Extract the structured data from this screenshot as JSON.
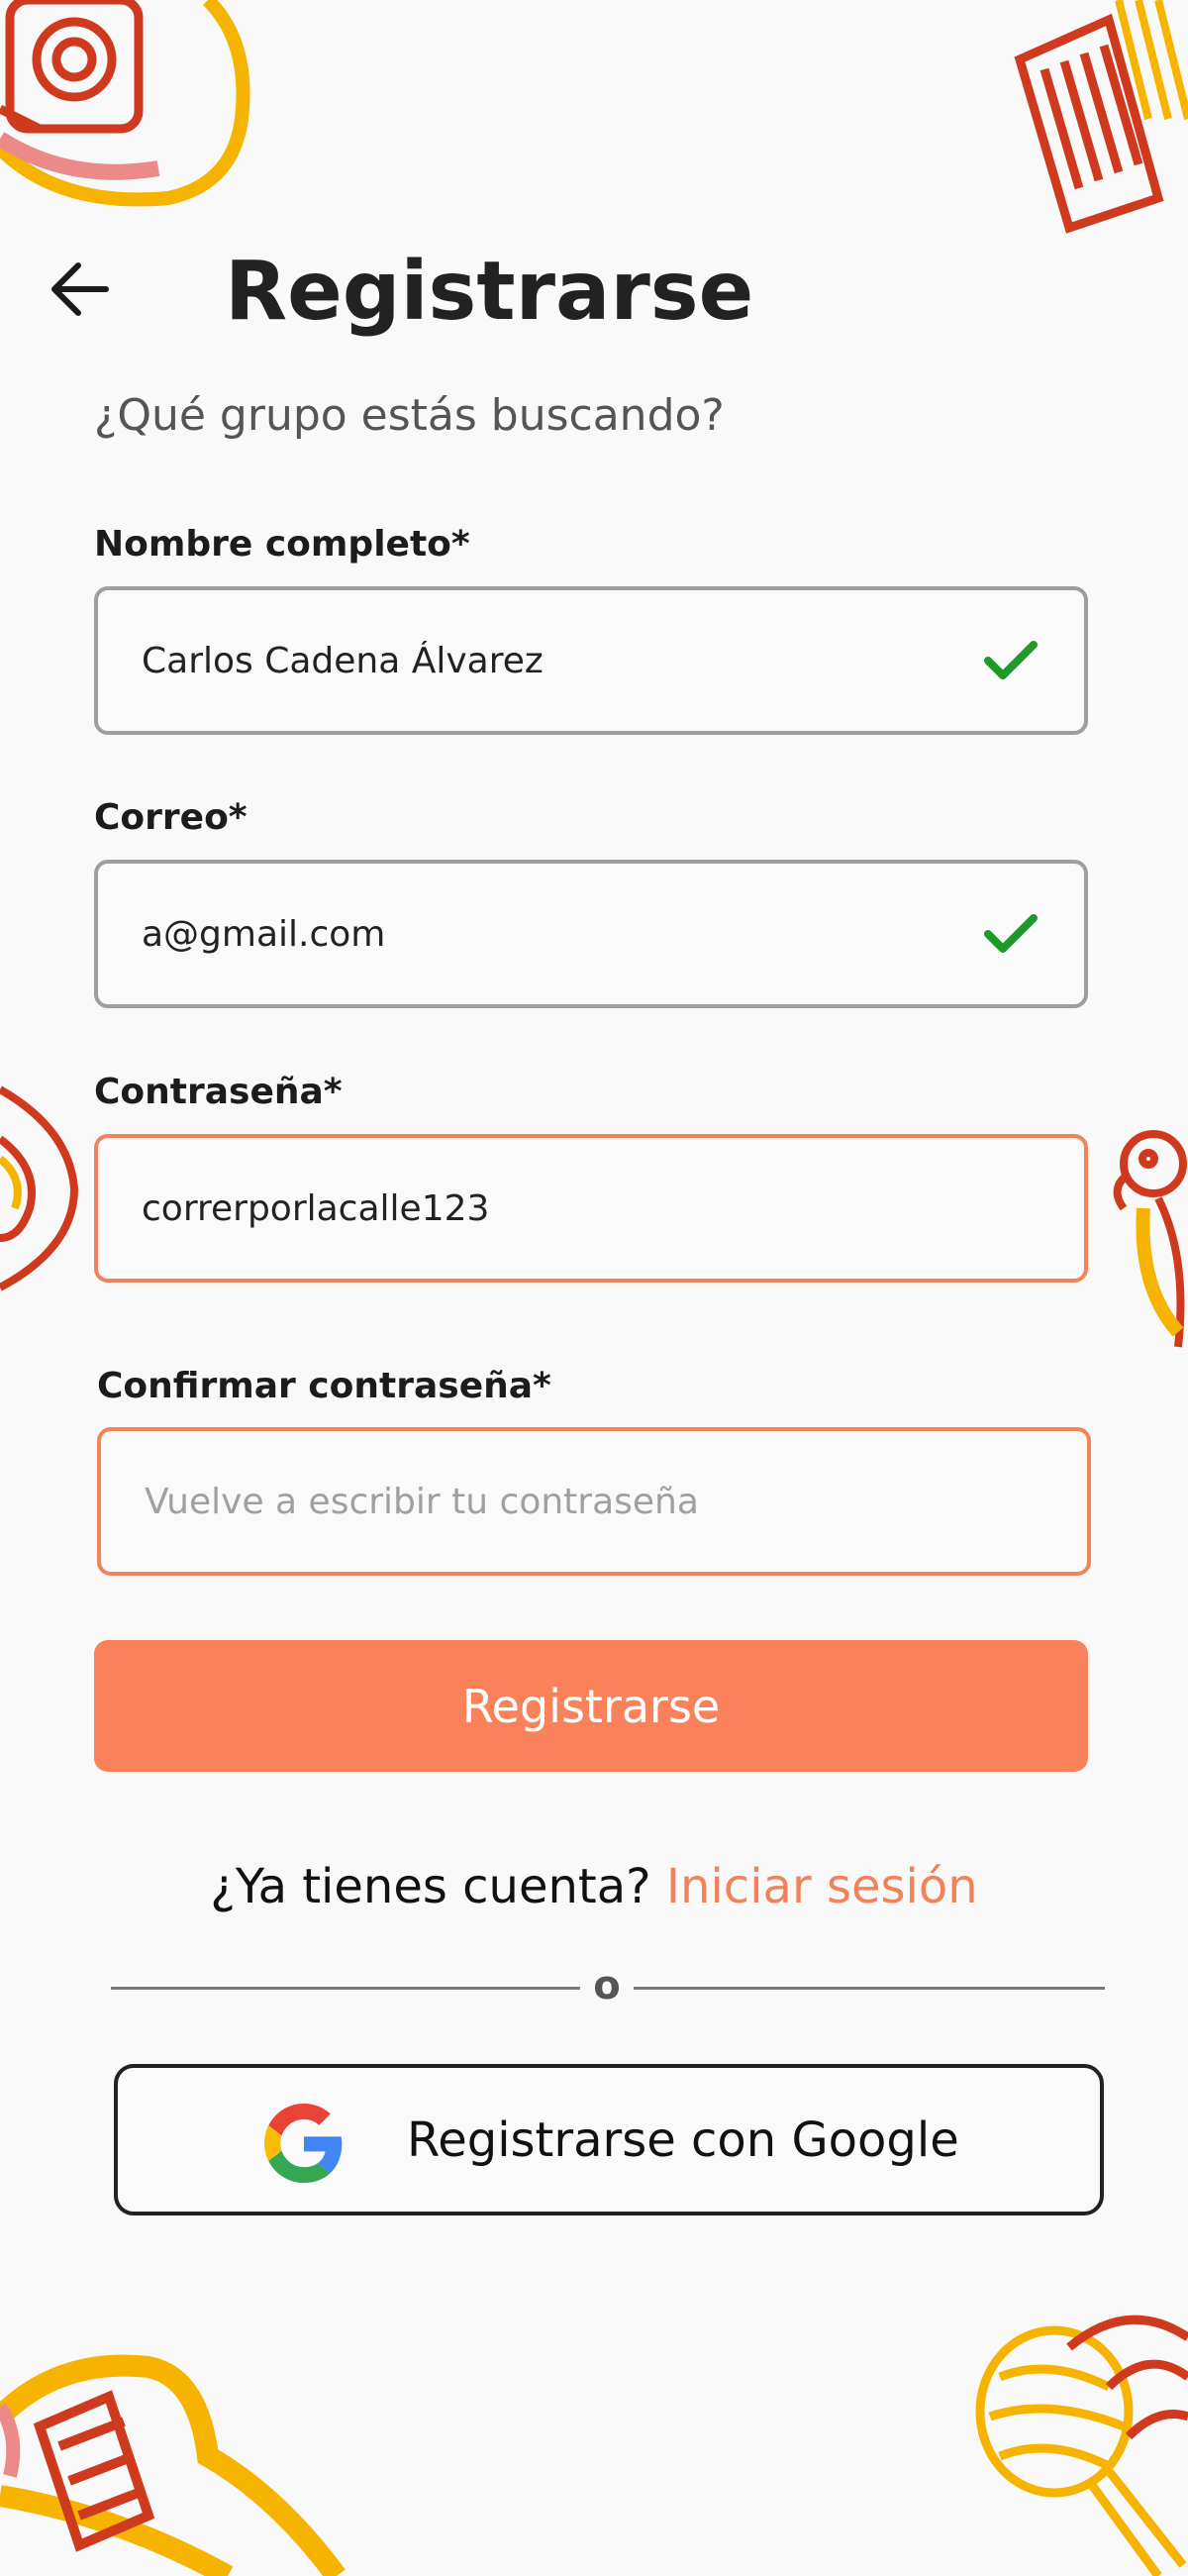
{
  "header": {
    "title": "Registrarse",
    "subtitle": "¿Qué grupo estás buscando?"
  },
  "form": {
    "full_name": {
      "label": "Nombre completo*",
      "value": "Carlos Cadena Álvarez",
      "valid": true
    },
    "email": {
      "label": "Correo*",
      "value": "a@gmail.com",
      "valid": true
    },
    "password": {
      "label": "Contraseña*",
      "value": "correrporlacalle123"
    },
    "confirm_password": {
      "label": "Confirmar contraseña*",
      "value": "",
      "placeholder": "Vuelve a escribir tu contraseña"
    },
    "submit_label": "Registrarse"
  },
  "login": {
    "prompt": "¿Ya tienes cuenta?",
    "link": "Iniciar sesión"
  },
  "divider_text": "o",
  "google": {
    "label": "Registrarse con Google",
    "icon": "google-icon"
  },
  "colors": {
    "accent": "#f9825a",
    "valid_check": "#1e9a2a",
    "background": "#f9f9f9"
  }
}
